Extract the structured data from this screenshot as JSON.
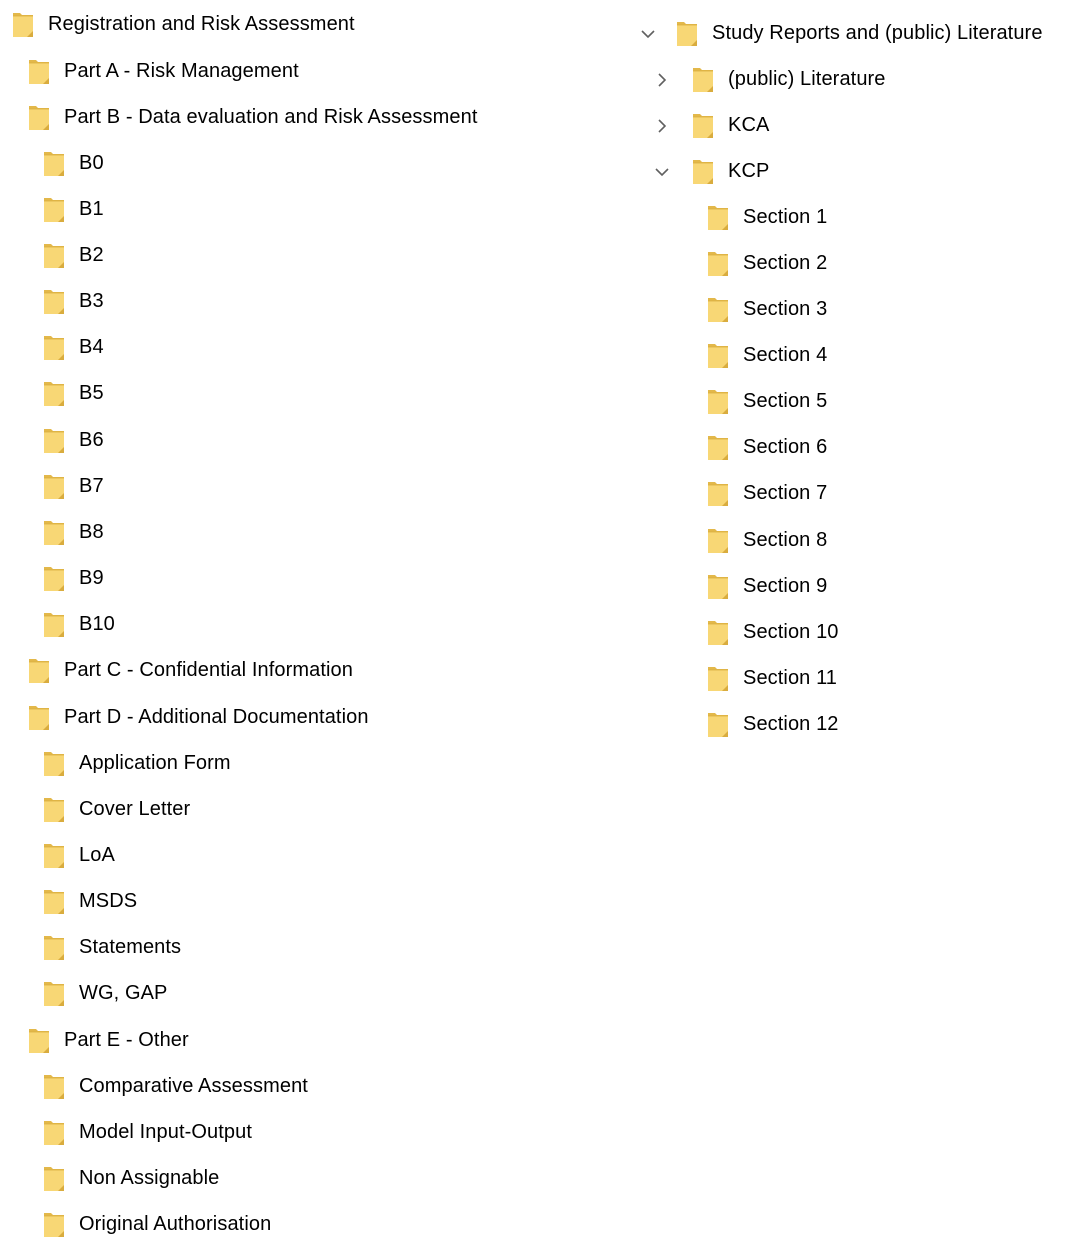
{
  "left_tree": {
    "root": {
      "label": "Registration and Risk Assessment"
    },
    "part_a": {
      "label": "Part A - Risk Management"
    },
    "part_b": {
      "label": "Part B - Data evaluation and Risk Assessment",
      "children": [
        "B0",
        "B1",
        "B2",
        "B3",
        "B4",
        "B5",
        "B6",
        "B7",
        "B8",
        "B9",
        "B10"
      ]
    },
    "part_c": {
      "label": "Part C - Confidential Information"
    },
    "part_d": {
      "label": "Part D - Additional Documentation",
      "children": [
        "Application Form",
        "Cover Letter",
        "LoA",
        "MSDS",
        "Statements",
        "WG, GAP"
      ]
    },
    "part_e": {
      "label": "Part E - Other",
      "children": [
        "Comparative Assessment",
        "Model Input-Output",
        "Non Assignable",
        "Original Authorisation"
      ]
    }
  },
  "right_tree": {
    "root": {
      "label": "Study Reports and (public) Literature",
      "expanded": true,
      "chevron_icon": "chevron-down-icon"
    },
    "literature": {
      "label": "(public) Literature",
      "expanded": false,
      "chevron_icon": "chevron-right-icon"
    },
    "kca": {
      "label": "KCA",
      "expanded": false,
      "chevron_icon": "chevron-right-icon"
    },
    "kcp": {
      "label": "KCP",
      "expanded": true,
      "chevron_icon": "chevron-down-icon",
      "children": [
        "Section 1",
        "Section 2",
        "Section 3",
        "Section 4",
        "Section 5",
        "Section 6",
        "Section 7",
        "Section 8",
        "Section 9",
        "Section 10",
        "Section 11",
        "Section 12"
      ]
    }
  },
  "icons": {
    "folder": "folder-icon",
    "folder_colors": {
      "body": "#F8D775",
      "back": "#E3B84A",
      "edge": "#D9AC3E"
    },
    "chevron_color": "#606060"
  }
}
